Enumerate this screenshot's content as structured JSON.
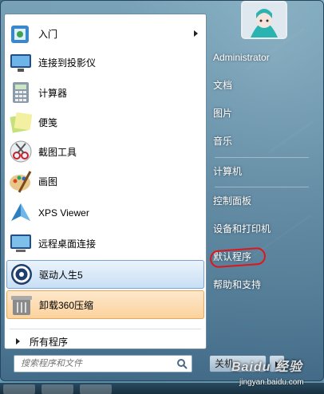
{
  "start_menu": {
    "left_items": [
      {
        "label": "入门",
        "icon": "getting-started-icon",
        "submenu": true
      },
      {
        "label": "连接到投影仪",
        "icon": "projector-icon"
      },
      {
        "label": "计算器",
        "icon": "calculator-icon"
      },
      {
        "label": "便笺",
        "icon": "sticky-notes-icon"
      },
      {
        "label": "截图工具",
        "icon": "snipping-tool-icon"
      },
      {
        "label": "画图",
        "icon": "paint-icon"
      },
      {
        "label": "XPS Viewer",
        "icon": "xps-viewer-icon"
      },
      {
        "label": "远程桌面连接",
        "icon": "remote-desktop-icon"
      },
      {
        "label": "驱动人生5",
        "icon": "driver-life-icon",
        "highlight": "blue"
      },
      {
        "label": "卸载360压缩",
        "icon": "uninstall-icon",
        "highlight": "orange"
      }
    ],
    "all_programs_label": "所有程序",
    "search_placeholder": "搜索程序和文件",
    "right_items": [
      {
        "label": "Administrator"
      },
      {
        "label": "文档"
      },
      {
        "label": "图片"
      },
      {
        "label": "音乐"
      },
      {
        "label": "计算机"
      },
      {
        "label": "控制面板"
      },
      {
        "label": "设备和打印机"
      },
      {
        "label": "默认程序",
        "annotated": true
      },
      {
        "label": "帮助和支持"
      }
    ],
    "shutdown_label": "关机"
  },
  "watermark": {
    "text": "Baidu 经验",
    "url": "jingyan.baidu.com"
  },
  "colors": {
    "annotation_red": "#e0141a",
    "highlight_blue": "#c9dff4",
    "highlight_orange": "#fbd29d"
  }
}
